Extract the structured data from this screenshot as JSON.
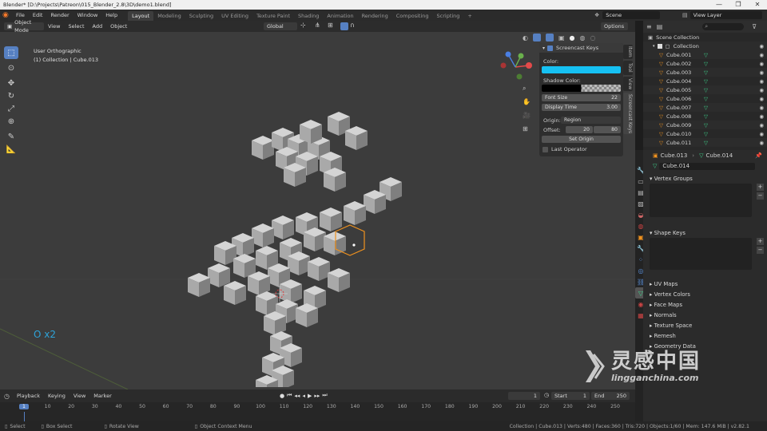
{
  "window": {
    "title": "Blender* [D:\\Projects\\Patreon\\015_Blender_2.8\\3D\\demo1.blend]",
    "minimize": "—",
    "maximize": "❐",
    "close": "✕"
  },
  "menu": [
    "File",
    "Edit",
    "Render",
    "Window",
    "Help"
  ],
  "workspaces": [
    "Layout",
    "Modeling",
    "Sculpting",
    "UV Editing",
    "Texture Paint",
    "Shading",
    "Animation",
    "Rendering",
    "Compositing",
    "Scripting"
  ],
  "add_workspace": "+",
  "scene": {
    "label": "Scene",
    "view_layer": "View Layer"
  },
  "viewport_header": {
    "mode": "Object Mode",
    "items": [
      "View",
      "Select",
      "Add",
      "Object"
    ],
    "orientation": "Global",
    "options": "Options"
  },
  "viewport": {
    "view_name": "User Orthographic",
    "collection_info": "(1) Collection | Cube.013",
    "key_overlay": "O x2"
  },
  "screencast_panel": {
    "title": "Screencast Keys",
    "color_label": "Color:",
    "color": "#16c1f3",
    "shadow_label": "Shadow Color:",
    "font_size_label": "Font Size",
    "font_size": "22",
    "display_time_label": "Display Time",
    "display_time": "3.00",
    "origin_label": "Origin:",
    "origin_value": "Region",
    "offset_label": "Offset:",
    "offset_x": "20",
    "offset_y": "80",
    "set_origin": "Set Origin",
    "last_operator": "Last Operator"
  },
  "side_tabs": [
    "Item",
    "Tool",
    "View",
    "Screencast Keys"
  ],
  "outliner": {
    "root": "Scene Collection",
    "collection": "Collection",
    "objects": [
      "Cube.001",
      "Cube.002",
      "Cube.003",
      "Cube.004",
      "Cube.005",
      "Cube.006",
      "Cube.007",
      "Cube.008",
      "Cube.009",
      "Cube.010",
      "Cube.011"
    ]
  },
  "properties": {
    "object": "Cube.013",
    "mesh": "Cube.014",
    "data_name": "Cube.014",
    "panels_open": [
      "Vertex Groups",
      "Shape Keys"
    ],
    "panels_closed": [
      "UV Maps",
      "Vertex Colors",
      "Face Maps",
      "Normals",
      "Texture Space",
      "Remesh",
      "Geometry Data"
    ]
  },
  "timeline": {
    "menus": [
      "Playback",
      "Keying",
      "View",
      "Marker"
    ],
    "current_frame": "1",
    "start_label": "Start",
    "start": "1",
    "end_label": "End",
    "end": "250",
    "ticks": [
      "1",
      "10",
      "20",
      "30",
      "40",
      "50",
      "60",
      "70",
      "80",
      "90",
      "100",
      "110",
      "120",
      "130",
      "140",
      "150",
      "160",
      "170",
      "180",
      "190",
      "200",
      "210",
      "220",
      "230",
      "240",
      "250"
    ]
  },
  "statusbar": {
    "select": "Select",
    "box_select": "Box Select",
    "rotate_view": "Rotate View",
    "context_menu": "Object Context Menu",
    "stats": "Collection | Cube.013 | Verts:480 | Faces:360 | Tris:720 | Objects:1/60 | Mem: 147.6 MiB | v2.82.1"
  },
  "watermark": {
    "cn": "灵感中国",
    "url": "lingganchina.com"
  },
  "colors": {
    "accent": "#5680c2",
    "selection": "#f0921e",
    "overlay_text": "#2ea3d8"
  }
}
